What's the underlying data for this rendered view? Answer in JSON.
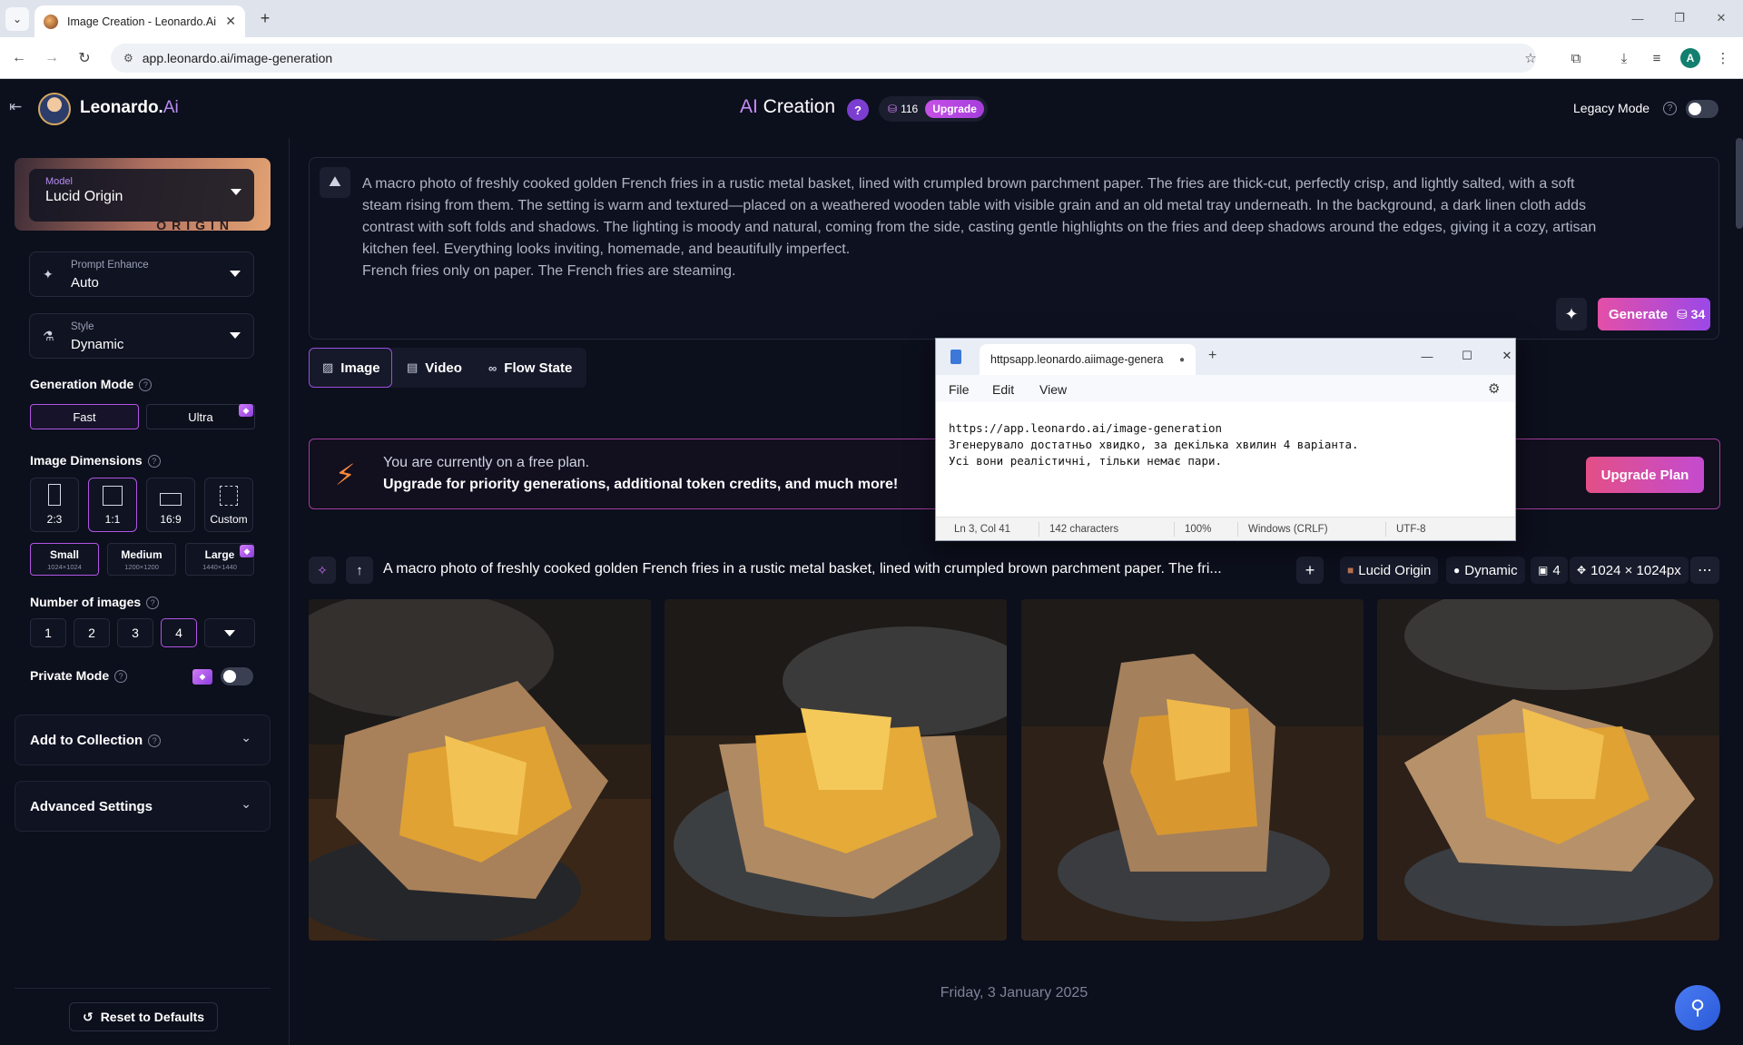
{
  "browser": {
    "tab_title": "Image Creation - Leonardo.Ai",
    "url": "app.leonardo.ai/image-generation",
    "profile_initial": "A"
  },
  "header": {
    "brand": "Leonardo.",
    "brand_suffix": "Ai",
    "title_ai": "AI",
    "title_rest": " Creation",
    "help": "?",
    "tokens": "116",
    "upgrade": "Upgrade",
    "legacy_mode": "Legacy Mode"
  },
  "sidebar": {
    "model_label": "Model",
    "model_value": "Lucid Origin",
    "model_banner_text": "ORIGIN",
    "prompt_enhance_label": "Prompt Enhance",
    "prompt_enhance_value": "Auto",
    "style_label": "Style",
    "style_value": "Dynamic",
    "generation_mode_title": "Generation Mode",
    "modes": [
      "Fast",
      "Ultra"
    ],
    "image_dimensions_title": "Image Dimensions",
    "dimensions": [
      "2:3",
      "1:1",
      "16:9",
      "Custom"
    ],
    "sizes": [
      {
        "label": "Small",
        "sub": "1024×1024"
      },
      {
        "label": "Medium",
        "sub": "1200×1200"
      },
      {
        "label": "Large",
        "sub": "1440×1440"
      }
    ],
    "number_of_images_title": "Number of images",
    "numbers": [
      "1",
      "2",
      "3",
      "4"
    ],
    "private_mode": "Private Mode",
    "add_to_collection": "Add to Collection",
    "advanced_settings": "Advanced Settings",
    "reset": "Reset to Defaults"
  },
  "prompt": {
    "text": "A macro photo of freshly cooked golden French fries in a rustic metal basket, lined with crumpled brown parchment paper. The fries are thick-cut, perfectly crisp, and lightly salted, with a soft\nsteam rising from them. The setting is warm and textured—placed on a weathered wooden table with visible grain and an old metal tray underneath. In the background, a dark linen cloth adds\ncontrast with soft folds and shadows. The lighting is moody and natural, coming from the side, casting gentle highlights on the fries and deep shadows around the edges, giving it a cozy, artisan\nkitchen feel. Everything looks inviting, homemade, and beautifully imperfect.\nFrench fries only on paper. The French fries are steaming.",
    "generate": "Generate",
    "generate_cost": "34"
  },
  "media_tabs": [
    "Image",
    "Video",
    "Flow State"
  ],
  "plan_banner": {
    "line1": "You are currently on a free plan.",
    "line2": "Upgrade for priority generations, additional token credits, and much more!",
    "button": "Upgrade Plan"
  },
  "generation": {
    "prompt_preview": "A macro photo of freshly cooked golden French fries in a rustic metal basket, lined with crumpled brown parchment paper. The fri...",
    "model": "Lucid Origin",
    "style": "Dynamic",
    "count": "4",
    "size": "1024 × 1024px"
  },
  "date_line": "Friday, 3 January 2025",
  "notepad": {
    "tab_title": "httpsapp.leonardo.aiimage-genera",
    "menus": [
      "File",
      "Edit",
      "View"
    ],
    "body": "https://app.leonardo.ai/image-generation\nЗгенерувало достатньо хвидко, за декілька хвилин 4 варіанта.\nУсі вони реалістичні, тільки немає пари.",
    "status_pos": "Ln 3, Col 41",
    "status_chars": "142 characters",
    "status_zoom": "100%",
    "status_eol": "Windows (CRLF)",
    "status_enc": "UTF-8"
  }
}
